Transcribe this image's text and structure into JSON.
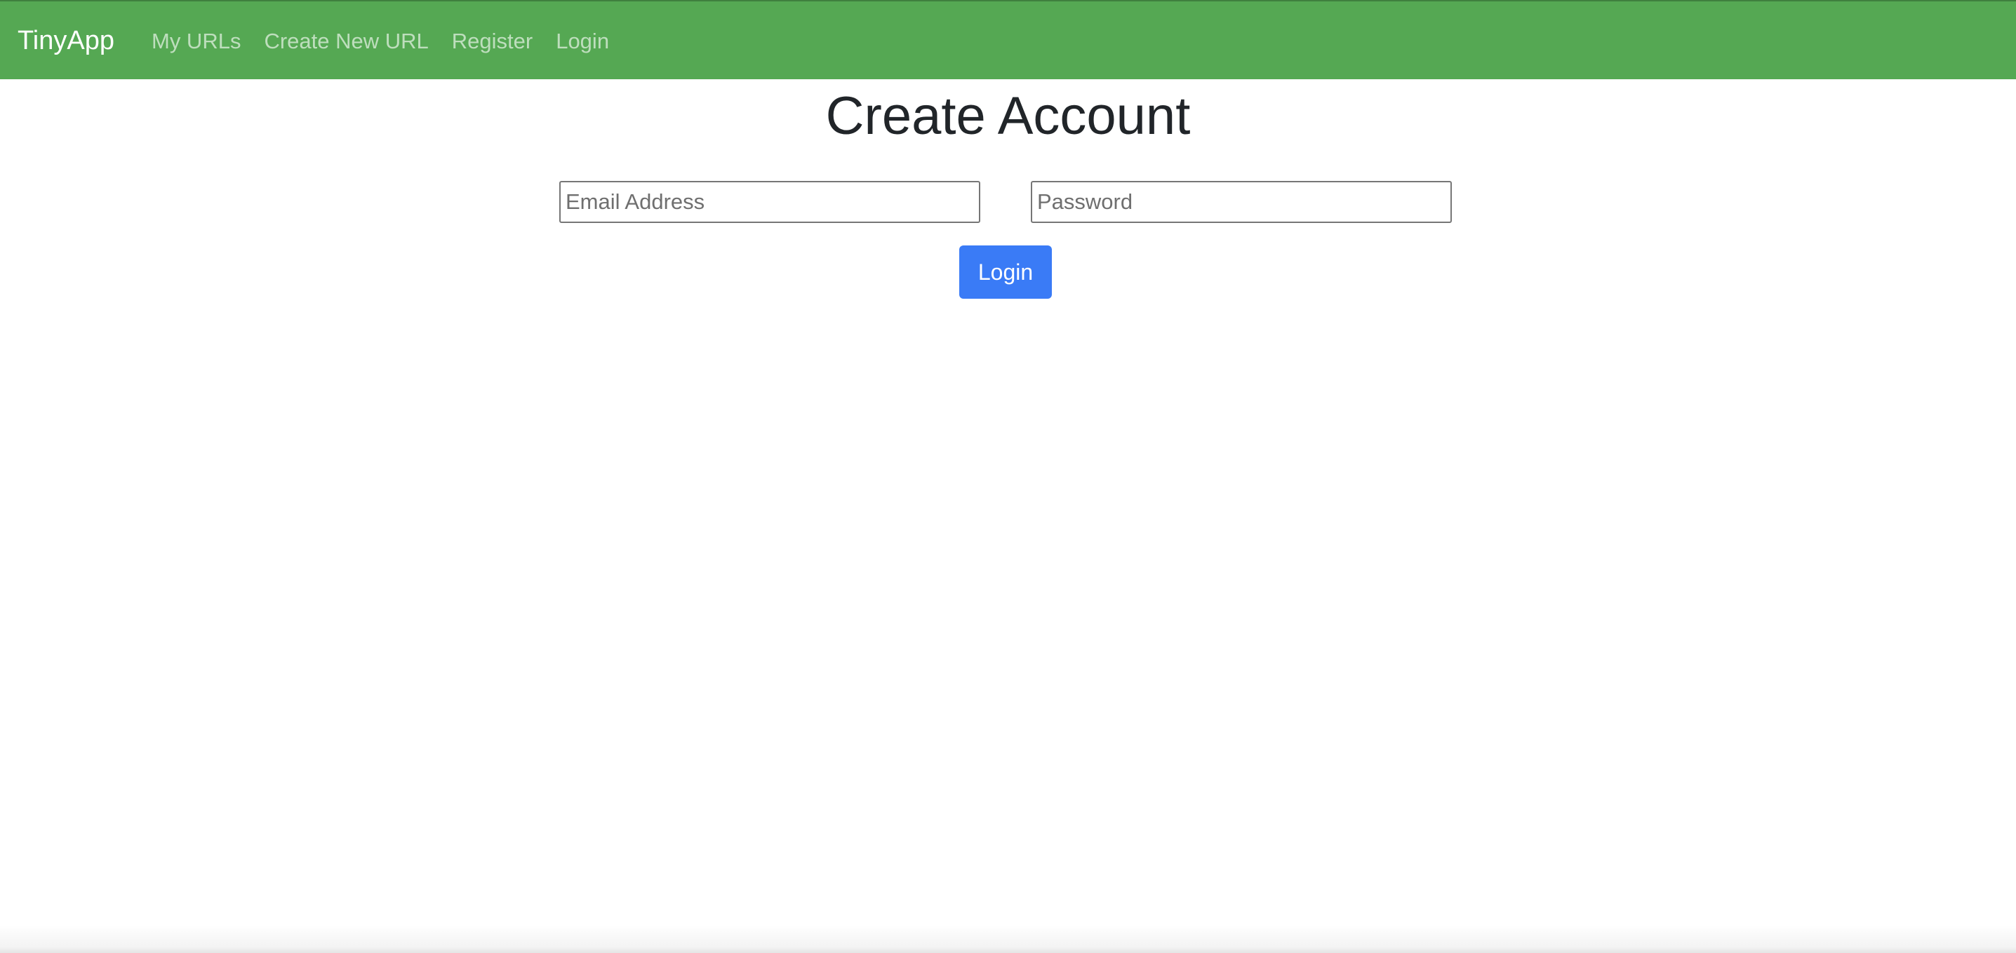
{
  "navbar": {
    "brand": "TinyApp",
    "links": [
      {
        "label": "My URLs"
      },
      {
        "label": "Create New URL"
      },
      {
        "label": "Register"
      },
      {
        "label": "Login"
      }
    ],
    "background_color": "#55a853"
  },
  "main": {
    "title": "Create Account",
    "email_field": {
      "placeholder": "Email Address",
      "value": ""
    },
    "password_field": {
      "placeholder": "Password",
      "value": ""
    },
    "submit_label": "Login",
    "submit_color": "#3a7bf6"
  }
}
